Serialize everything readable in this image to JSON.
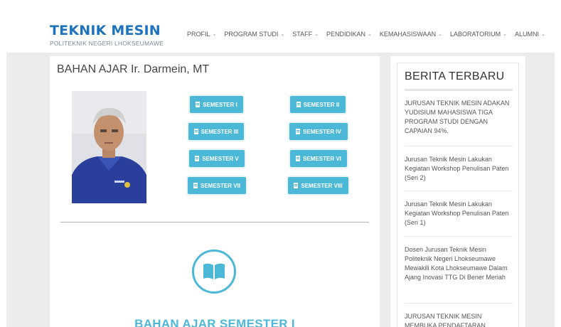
{
  "brand": {
    "title": "TEKNIK MESIN",
    "subtitle": "POLITEKNIK NEGERI LHOKSEUMAWE"
  },
  "nav": [
    {
      "label": "PROFIL"
    },
    {
      "label": "PROGRAM STUDI"
    },
    {
      "label": "STAFF"
    },
    {
      "label": "PENDIDIKAN"
    },
    {
      "label": "KEMAHASISWAAN"
    },
    {
      "label": "LABORATORIUM"
    },
    {
      "label": "ALUMNI"
    }
  ],
  "main": {
    "title": "BAHAN AJAR Ir. Darmein, MT",
    "semesters": [
      {
        "label": "SEMESTER I"
      },
      {
        "label": "SEMESTER II"
      },
      {
        "label": "SEMESTER III"
      },
      {
        "label": "SEMESTER IV"
      },
      {
        "label": "SEMESTER V"
      },
      {
        "label": "SEMESTER VI"
      },
      {
        "label": "SEMESTER VII"
      },
      {
        "label": "SEMESTER VIII"
      }
    ],
    "section_heading": "BAHAN AJAR SEMESTER I"
  },
  "sidebar": {
    "title": "BERITA TERBARU",
    "news": [
      {
        "text": "JURUSAN TEKNIK MESIN ADAKAN YUDISIUM MAHASISWA TIGA PROGRAM STUDI DENGAN CAPAIAN 94%."
      },
      {
        "text": "Jurusan Teknik Mesin Lakukan Kegiatan Workshop Penulisan Paten (Seri 2)"
      },
      {
        "text": "Jurusan Teknik Mesin Lakukan Kegiatan Workshop Penulisan Paten (Seri 1)"
      },
      {
        "text": "Dosen Jurusan Teknik Mesin Politeknik Negeri Lhokseumawe Mewakili Kota Lhokseumawe Dalam Ajang Inovasi TTG Di Bener Meriah"
      },
      {
        "text": "JURUSAN TEKNIK MESIN MEMBUKA PENDAFTARAN"
      }
    ]
  },
  "colors": {
    "brand": "#1e73be",
    "accent": "#4cb8d8",
    "background": "#ececec"
  },
  "icons": {
    "nav_dropdown": "chevron-down-icon",
    "button": "document-icon",
    "section": "book-icon"
  }
}
